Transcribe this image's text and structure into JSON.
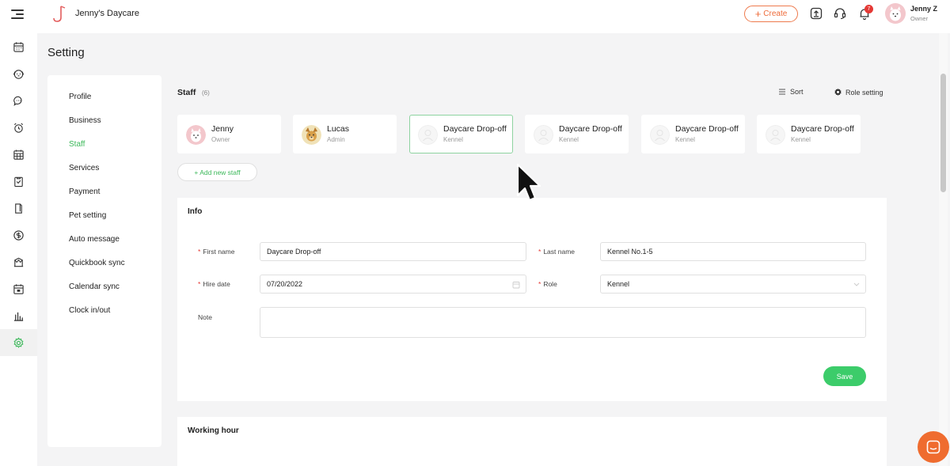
{
  "app": {
    "title": "Jenny's Daycare"
  },
  "topbar": {
    "create_label": "Create",
    "notification_count": "7",
    "user": {
      "name": "Jenny Z",
      "role": "Owner"
    }
  },
  "page": {
    "title": "Setting"
  },
  "settings_menu": {
    "items": [
      {
        "label": "Profile"
      },
      {
        "label": "Business"
      },
      {
        "label": "Staff"
      },
      {
        "label": "Services"
      },
      {
        "label": "Payment"
      },
      {
        "label": "Pet setting"
      },
      {
        "label": "Auto message"
      },
      {
        "label": "Quickbook sync"
      },
      {
        "label": "Calendar sync"
      },
      {
        "label": "Clock in/out"
      }
    ],
    "active": "Staff"
  },
  "staff": {
    "label": "Staff",
    "count": "(6)",
    "sort_label": "Sort",
    "role_setting_label": "Role setting",
    "add_label": "+ Add new staff",
    "members": [
      {
        "name": "Jenny",
        "role": "Owner",
        "avatar": "dog-white"
      },
      {
        "name": "Lucas",
        "role": "Admin",
        "avatar": "dog-yellow"
      },
      {
        "name": "Daycare Drop-off",
        "role": "Kennel",
        "avatar": "placeholder"
      },
      {
        "name": "Daycare Drop-off",
        "role": "Kennel",
        "avatar": "placeholder"
      },
      {
        "name": "Daycare Drop-off",
        "role": "Kennel",
        "avatar": "placeholder"
      },
      {
        "name": "Daycare Drop-off",
        "role": "Kennel",
        "avatar": "placeholder"
      }
    ],
    "selected_index": 2
  },
  "info": {
    "title": "Info",
    "first_name_label": "First name",
    "first_name_value": "Daycare Drop-off",
    "last_name_label": "Last name",
    "last_name_value": "Kennel No.1-5",
    "hire_date_label": "Hire date",
    "hire_date_value": "07/20/2022",
    "role_label": "Role",
    "role_value": "Kennel",
    "note_label": "Note",
    "note_value": "",
    "save_label": "Save"
  },
  "working_hour": {
    "title": "Working hour"
  },
  "colors": {
    "accent_green": "#3cb85a",
    "accent_orange": "#ee6b39",
    "badge_red": "#e53935"
  }
}
